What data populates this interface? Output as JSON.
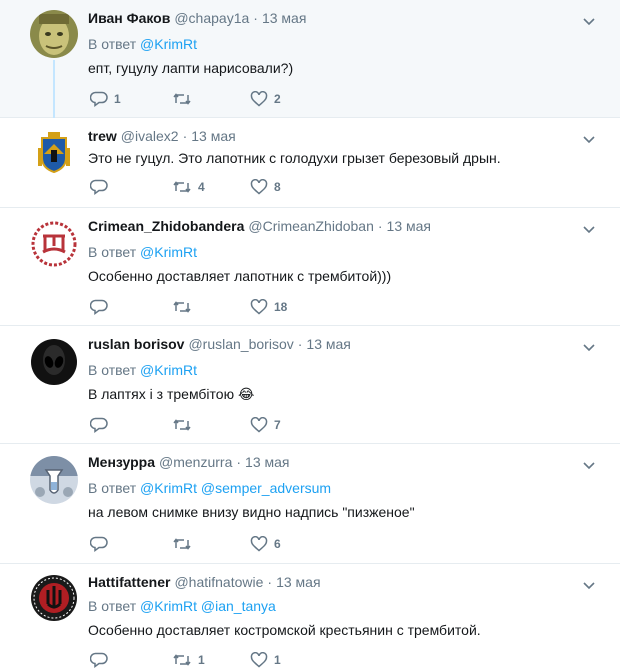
{
  "tweets": [
    {
      "fullname": "Иван Факов",
      "username": "@chapay1a",
      "time": "13 мая",
      "reply_prefix": "В ответ",
      "mentions": [
        "@KrimRt"
      ],
      "text": "епт, гуцулу лапти нарисовали?)",
      "replies": "1",
      "retweets": "",
      "likes": "2",
      "highlighted": true
    },
    {
      "fullname": "trew",
      "username": "@ivalex2",
      "time": "13 мая",
      "reply_prefix": "",
      "mentions": [],
      "text": "Это не гуцул. Это лапотник с голодухи грызет березовый дрын.",
      "replies": "",
      "retweets": "4",
      "likes": "8",
      "highlighted": false
    },
    {
      "fullname": "Crimean_Zhidobandera",
      "username": "@CrimeanZhidoban",
      "time": "13 мая",
      "reply_prefix": "В ответ",
      "mentions": [
        "@KrimRt"
      ],
      "text": "Особенно доставляет лапотник с трембитой)))",
      "replies": "",
      "retweets": "",
      "likes": "18",
      "highlighted": false
    },
    {
      "fullname": "ruslan borisov",
      "username": "@ruslan_borisov",
      "time": "13 мая",
      "reply_prefix": "В ответ",
      "mentions": [
        "@KrimRt"
      ],
      "text": "В лаптях і з трембітою",
      "emoji": "😂",
      "replies": "",
      "retweets": "",
      "likes": "7",
      "highlighted": false
    },
    {
      "fullname": "Мензурра",
      "username": "@menzurra",
      "time": "13 мая",
      "reply_prefix": "В ответ",
      "mentions": [
        "@KrimRt",
        "@semper_adversum"
      ],
      "text": "на левом снимке внизу видно надпись \"пизженое\"",
      "replies": "",
      "retweets": "",
      "likes": "6",
      "highlighted": false
    },
    {
      "fullname": "Hattifattener",
      "username": "@hatifnatowie",
      "time": "13 мая",
      "reply_prefix": "В ответ",
      "mentions": [
        "@KrimRt",
        "@ian_tanya"
      ],
      "text": "Особенно доставляет костромской крестьянин с трембитой.",
      "replies": "",
      "retweets": "1",
      "likes": "1",
      "highlighted": false
    }
  ],
  "icons": {
    "reply": "reply-icon",
    "retweet": "retweet-icon",
    "like": "heart-icon",
    "menu": "chevron-down-icon"
  },
  "colors": {
    "link": "#1da1f2",
    "muted": "#657786",
    "text": "#14171a",
    "highlight_bg": "#f5f8fa",
    "thread_line": "#c4e6ff"
  }
}
